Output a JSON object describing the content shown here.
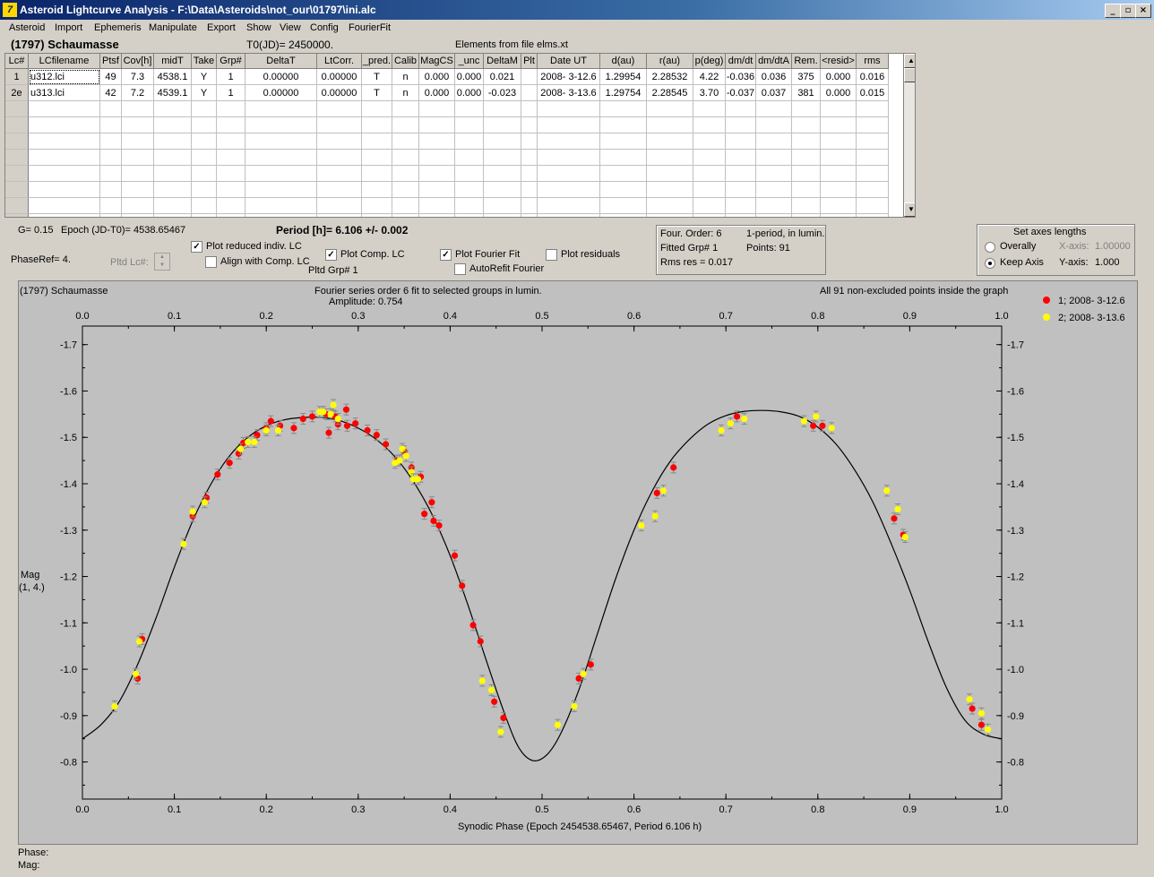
{
  "window": {
    "title": "Asteroid Lightcurve Analysis - F:\\Data\\Asteroids\\not_our\\01797\\ini.alc",
    "icon": "app-icon",
    "controls": [
      "_",
      "▫",
      "×"
    ]
  },
  "menu": [
    "Asteroid",
    "Import",
    "Ephemeris",
    "Manipulate",
    "Export",
    "Show",
    "View",
    "Config",
    "FourierFit"
  ],
  "header": {
    "asteroid": "(1797) Schaumasse",
    "t0": "T0(JD)= 2450000.",
    "elements": "Elements from file elms.xt"
  },
  "table": {
    "columns": [
      "Lc#",
      "LCfilename",
      "Ptsf",
      "Cov[h]",
      "midT",
      "Take",
      "Grp#",
      "DeltaT",
      "LtCorr.",
      "_pred.",
      "Calib",
      "MagCS",
      "_unc",
      "DeltaM",
      "Plt",
      "Date UT",
      "d(au)",
      "r(au)",
      "p(deg)",
      "dm/dt",
      "dm/dtA",
      "Rem.",
      "<resid>",
      "rms res"
    ],
    "rows": [
      [
        "1",
        "u312.lci",
        "49",
        "7.3",
        "4538.1",
        "Y",
        "1",
        "0.00000",
        "0.00000",
        "T",
        "n",
        "0.000",
        "0.000",
        "0.021",
        "",
        "2008- 3-12.6",
        "1.29954",
        "2.28532",
        "4.22",
        "-0.036",
        "0.036",
        "375",
        "0.000",
        "0.016"
      ],
      [
        "2e",
        "u313.lci",
        "42",
        "7.2",
        "4539.1",
        "Y",
        "1",
        "0.00000",
        "0.00000",
        "T",
        "n",
        "0.000",
        "0.000",
        "-0.023",
        "",
        "2008- 3-13.6",
        "1.29754",
        "2.28545",
        "3.70",
        "-0.037",
        "0.037",
        "381",
        "0.000",
        "0.015"
      ]
    ]
  },
  "controls": {
    "g": "G= 0.15",
    "epoch": "Epoch (JD-T0)= 4538.65467",
    "period": "Period [h]= 6.106 +/- 0.002",
    "phaseref": "PhaseRef= 4.",
    "pltd_lc": "Pltd Lc#:",
    "plot_reduced": "Plot reduced indiv. LC",
    "align_comp": "Align with Comp. LC",
    "plot_comp": "Plot Comp. LC",
    "pltd_grp": "Pltd Grp#  1",
    "plot_fourier": "Plot Fourier Fit",
    "autorefit": "AutoRefit Fourier",
    "plot_residuals": "Plot residuals",
    "check_glyph": "✓"
  },
  "fourier_info": {
    "order": "Four. Order:  6",
    "mode": "1-period, in lumin.",
    "fitted": "Fitted Grp# 1",
    "points": "Points: 91",
    "rms": "Rms res     = 0.017"
  },
  "axes_box": {
    "title": "Set axes lengths",
    "overally": "Overally",
    "keep_axis": "Keep Axis",
    "xaxis_label": "X-axis:",
    "xaxis_value": "1.00000",
    "yaxis_label": "Y-axis:",
    "yaxis_value": "1.000"
  },
  "status": {
    "phase": "Phase:",
    "mag": "Mag:"
  },
  "chart_data": {
    "type": "scatter",
    "title_left": "(1797) Schaumasse",
    "title_center": "Fourier series order 6 fit to selected groups in lumin.",
    "subtitle": "Amplitude: 0.754",
    "title_right": "All 91 non-excluded points inside the graph",
    "xlabel": "Synodic Phase (Epoch 2454538.65467, Period 6.106 h)",
    "ylabel": "Mag",
    "ylabel2": "(1, 4.)",
    "xlim": [
      0.0,
      1.0
    ],
    "ylim": [
      -0.72,
      -1.74
    ],
    "x_ticks": [
      "0.0",
      "0.1",
      "0.2",
      "0.3",
      "0.4",
      "0.5",
      "0.6",
      "0.7",
      "0.8",
      "0.9",
      "1.0"
    ],
    "y_ticks": [
      "-1.7",
      "-1.6",
      "-1.5",
      "-1.4",
      "-1.3",
      "-1.2",
      "-1.1",
      "-1.0",
      "-0.9",
      "-0.8"
    ],
    "legend_position": "top-right",
    "series": [
      {
        "name": "1; 2008- 3-12.6",
        "color": "#ff0000",
        "points": [
          [
            0.06,
            -0.98
          ],
          [
            0.065,
            -1.065
          ],
          [
            0.12,
            -1.33
          ],
          [
            0.135,
            -1.37
          ],
          [
            0.147,
            -1.42
          ],
          [
            0.16,
            -1.445
          ],
          [
            0.17,
            -1.465
          ],
          [
            0.175,
            -1.488
          ],
          [
            0.19,
            -1.505
          ],
          [
            0.2,
            -1.52
          ],
          [
            0.205,
            -1.535
          ],
          [
            0.215,
            -1.525
          ],
          [
            0.23,
            -1.52
          ],
          [
            0.24,
            -1.54
          ],
          [
            0.25,
            -1.545
          ],
          [
            0.265,
            -1.55
          ],
          [
            0.268,
            -1.51
          ],
          [
            0.275,
            -1.545
          ],
          [
            0.278,
            -1.528
          ],
          [
            0.287,
            -1.56
          ],
          [
            0.288,
            -1.525
          ],
          [
            0.297,
            -1.53
          ],
          [
            0.31,
            -1.515
          ],
          [
            0.32,
            -1.505
          ],
          [
            0.33,
            -1.485
          ],
          [
            0.342,
            -1.45
          ],
          [
            0.35,
            -1.47
          ],
          [
            0.358,
            -1.435
          ],
          [
            0.368,
            -1.415
          ],
          [
            0.372,
            -1.335
          ],
          [
            0.38,
            -1.36
          ],
          [
            0.382,
            -1.32
          ],
          [
            0.388,
            -1.31
          ],
          [
            0.405,
            -1.245
          ],
          [
            0.413,
            -1.18
          ],
          [
            0.425,
            -1.095
          ],
          [
            0.433,
            -1.06
          ],
          [
            0.448,
            -0.93
          ],
          [
            0.458,
            -0.895
          ],
          [
            0.54,
            -0.98
          ],
          [
            0.553,
            -1.01
          ],
          [
            0.625,
            -1.38
          ],
          [
            0.643,
            -1.435
          ],
          [
            0.712,
            -1.545
          ],
          [
            0.795,
            -1.525
          ],
          [
            0.805,
            -1.525
          ],
          [
            0.883,
            -1.325
          ],
          [
            0.893,
            -1.29
          ],
          [
            0.968,
            -0.915
          ],
          [
            0.978,
            -0.88
          ]
        ]
      },
      {
        "name": "2; 2008- 3-13.6",
        "color": "#ffff00",
        "points": [
          [
            0.035,
            -0.92
          ],
          [
            0.058,
            -0.99
          ],
          [
            0.062,
            -1.06
          ],
          [
            0.11,
            -1.27
          ],
          [
            0.12,
            -1.34
          ],
          [
            0.133,
            -1.36
          ],
          [
            0.172,
            -1.475
          ],
          [
            0.18,
            -1.49
          ],
          [
            0.187,
            -1.49
          ],
          [
            0.2,
            -1.515
          ],
          [
            0.213,
            -1.515
          ],
          [
            0.258,
            -1.555
          ],
          [
            0.262,
            -1.555
          ],
          [
            0.27,
            -1.55
          ],
          [
            0.273,
            -1.57
          ],
          [
            0.278,
            -1.54
          ],
          [
            0.34,
            -1.445
          ],
          [
            0.345,
            -1.45
          ],
          [
            0.348,
            -1.475
          ],
          [
            0.352,
            -1.46
          ],
          [
            0.358,
            -1.425
          ],
          [
            0.36,
            -1.41
          ],
          [
            0.365,
            -1.41
          ],
          [
            0.435,
            -0.975
          ],
          [
            0.445,
            -0.955
          ],
          [
            0.455,
            -0.865
          ],
          [
            0.517,
            -0.88
          ],
          [
            0.535,
            -0.92
          ],
          [
            0.545,
            -0.99
          ],
          [
            0.608,
            -1.31
          ],
          [
            0.623,
            -1.33
          ],
          [
            0.632,
            -1.385
          ],
          [
            0.695,
            -1.515
          ],
          [
            0.705,
            -1.53
          ],
          [
            0.72,
            -1.54
          ],
          [
            0.785,
            -1.535
          ],
          [
            0.798,
            -1.545
          ],
          [
            0.815,
            -1.52
          ],
          [
            0.875,
            -1.385
          ],
          [
            0.887,
            -1.345
          ],
          [
            0.895,
            -1.285
          ],
          [
            0.965,
            -0.935
          ],
          [
            0.978,
            -0.905
          ],
          [
            0.985,
            -0.87
          ]
        ]
      }
    ],
    "fit": {
      "amplitude": 0.754,
      "phase_min_x": 0.49,
      "curve_points": [
        [
          0.0,
          -0.85
        ],
        [
          0.02,
          -0.88
        ],
        [
          0.04,
          -0.93
        ],
        [
          0.06,
          -1.01
        ],
        [
          0.08,
          -1.11
        ],
        [
          0.1,
          -1.22
        ],
        [
          0.12,
          -1.32
        ],
        [
          0.14,
          -1.4
        ],
        [
          0.16,
          -1.46
        ],
        [
          0.18,
          -1.5
        ],
        [
          0.2,
          -1.525
        ],
        [
          0.22,
          -1.538
        ],
        [
          0.24,
          -1.543
        ],
        [
          0.26,
          -1.543
        ],
        [
          0.28,
          -1.536
        ],
        [
          0.3,
          -1.52
        ],
        [
          0.32,
          -1.495
        ],
        [
          0.34,
          -1.458
        ],
        [
          0.36,
          -1.405
        ],
        [
          0.38,
          -1.335
        ],
        [
          0.4,
          -1.245
        ],
        [
          0.42,
          -1.135
        ],
        [
          0.44,
          -1.015
        ],
        [
          0.46,
          -0.9
        ],
        [
          0.475,
          -0.83
        ],
        [
          0.49,
          -0.803
        ],
        [
          0.505,
          -0.815
        ],
        [
          0.52,
          -0.86
        ],
        [
          0.54,
          -0.955
        ],
        [
          0.56,
          -1.075
        ],
        [
          0.58,
          -1.195
        ],
        [
          0.6,
          -1.3
        ],
        [
          0.62,
          -1.385
        ],
        [
          0.64,
          -1.45
        ],
        [
          0.66,
          -1.495
        ],
        [
          0.68,
          -1.528
        ],
        [
          0.7,
          -1.547
        ],
        [
          0.72,
          -1.556
        ],
        [
          0.74,
          -1.558
        ],
        [
          0.76,
          -1.555
        ],
        [
          0.78,
          -1.545
        ],
        [
          0.8,
          -1.522
        ],
        [
          0.82,
          -1.485
        ],
        [
          0.84,
          -1.43
        ],
        [
          0.86,
          -1.36
        ],
        [
          0.88,
          -1.27
        ],
        [
          0.9,
          -1.17
        ],
        [
          0.92,
          -1.06
        ],
        [
          0.94,
          -0.96
        ],
        [
          0.96,
          -0.89
        ],
        [
          0.98,
          -0.86
        ],
        [
          1.0,
          -0.85
        ]
      ]
    }
  }
}
